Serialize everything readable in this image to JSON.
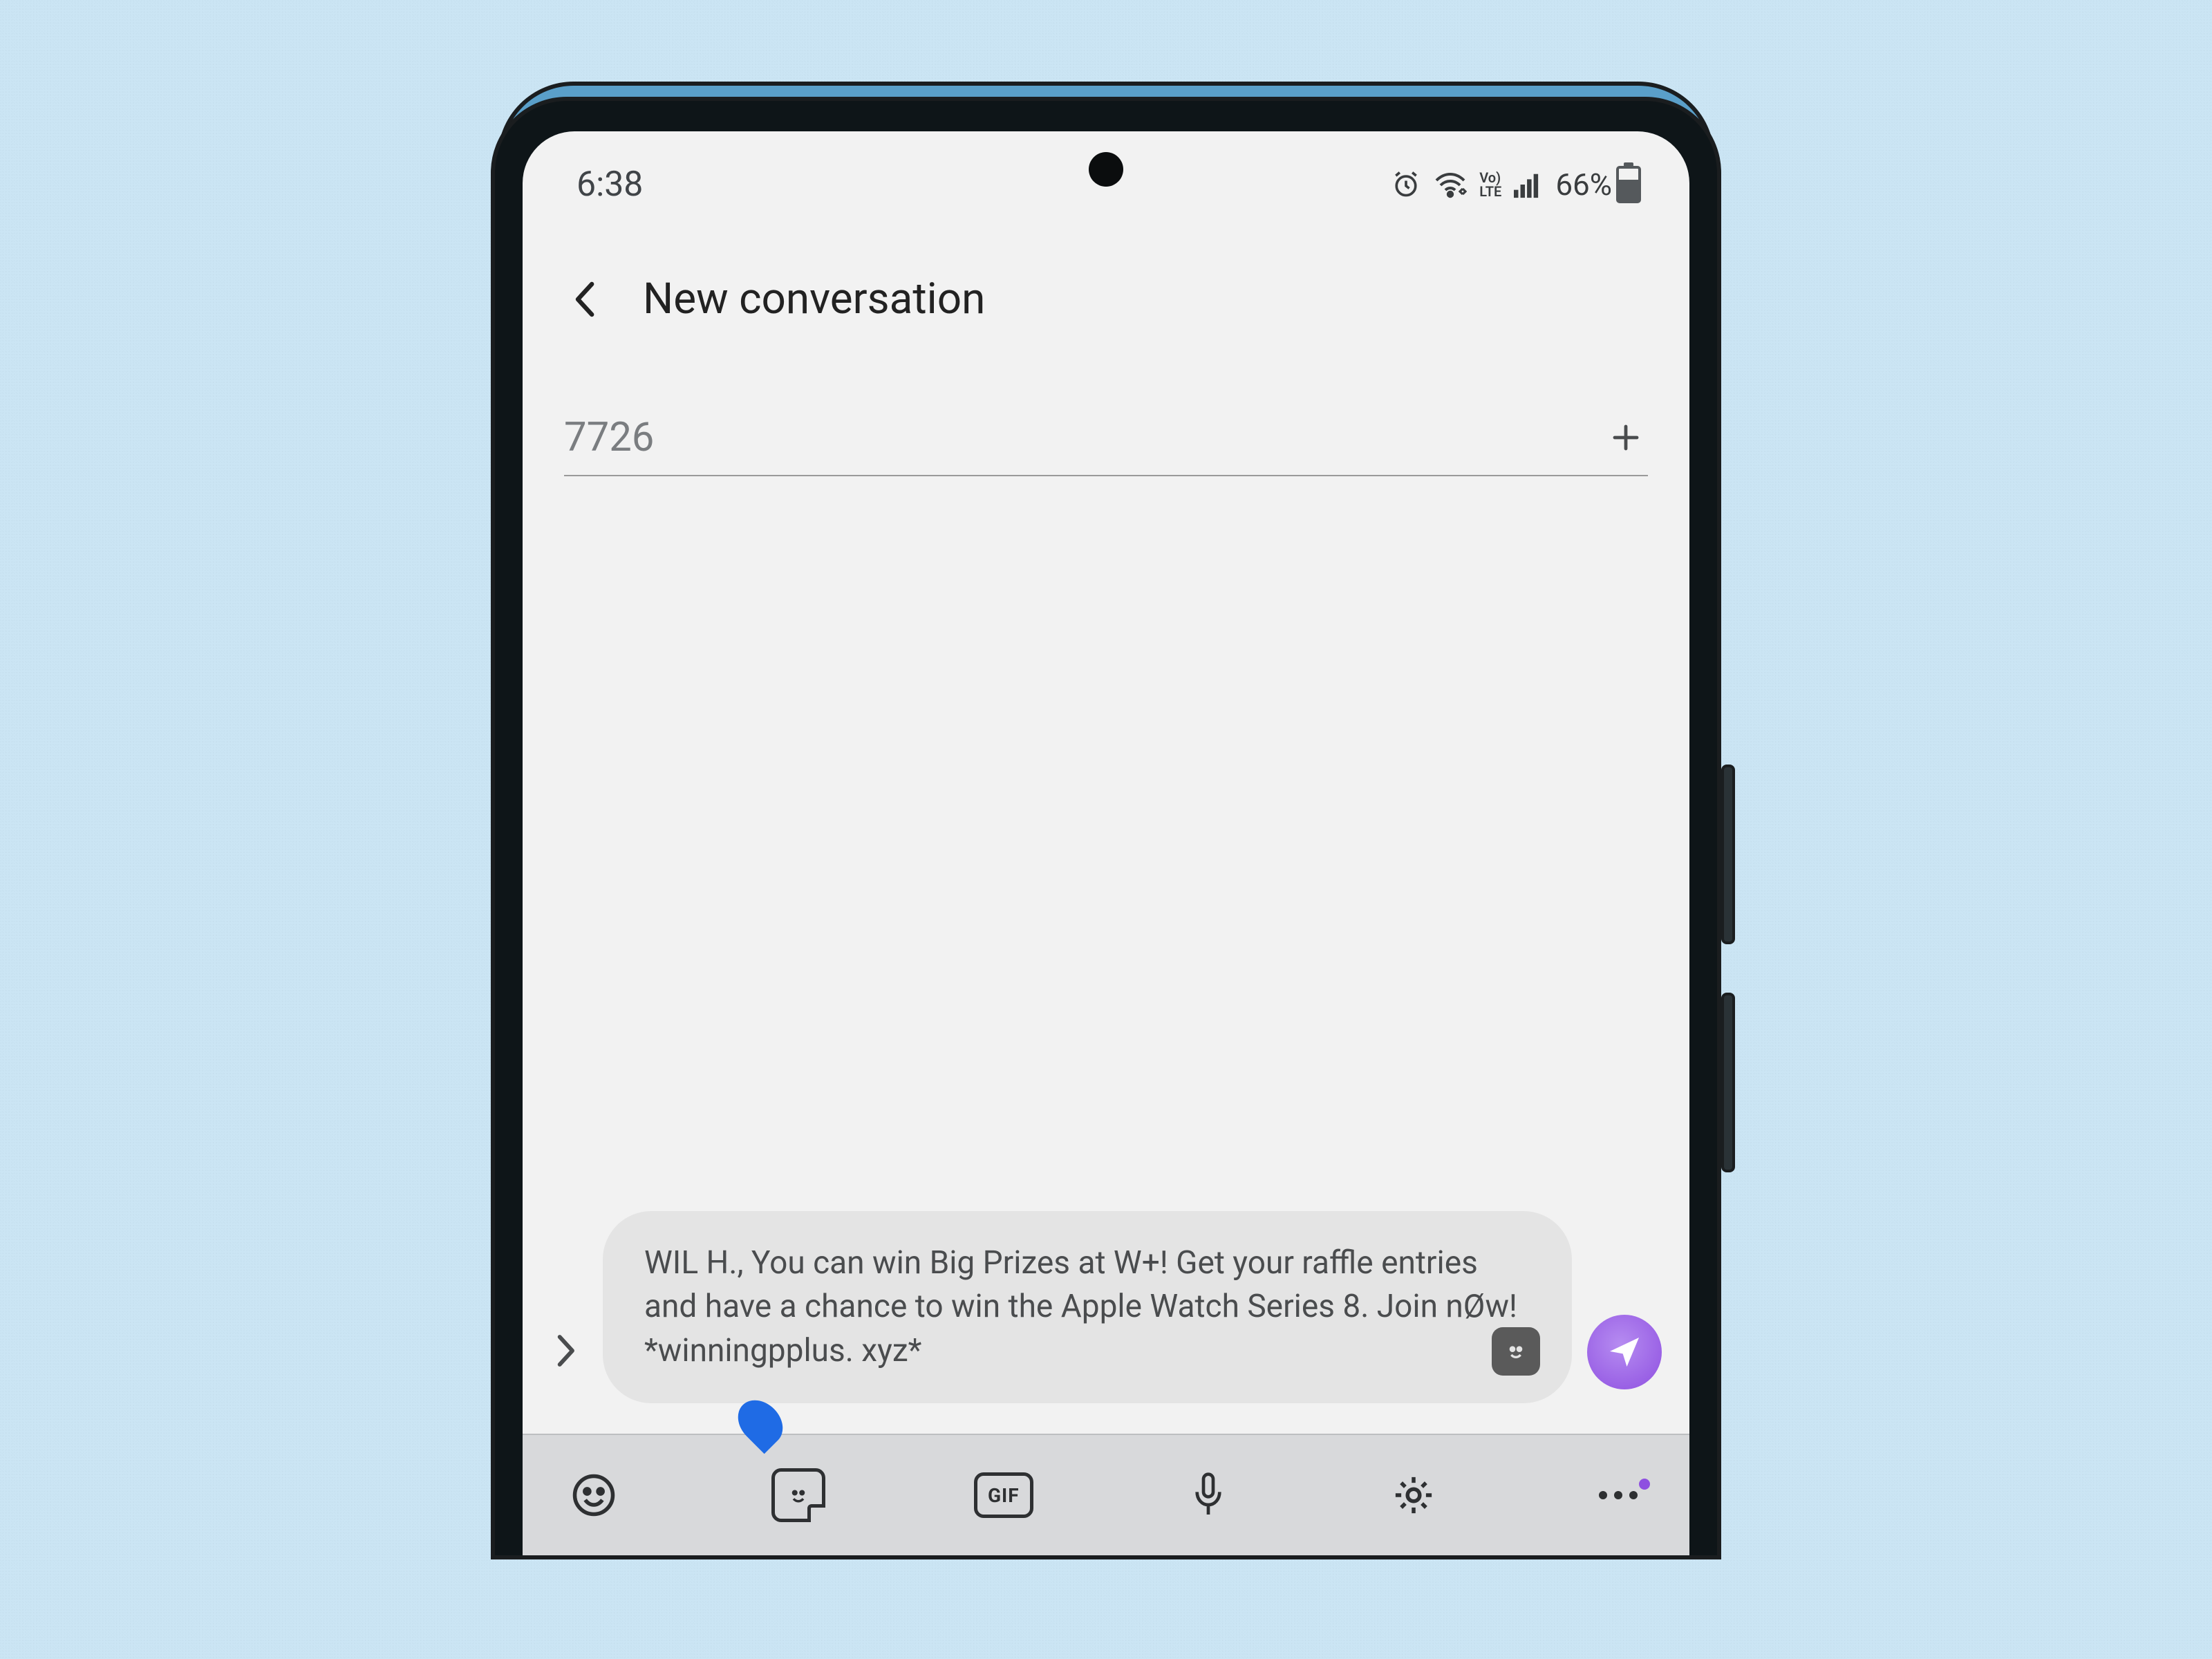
{
  "status": {
    "time": "6:38",
    "volte_top": "Vo)",
    "volte_bottom": "LTE",
    "battery_percent": "66%"
  },
  "header": {
    "title": "New conversation"
  },
  "recipient": {
    "value": "7726"
  },
  "compose": {
    "message": "WIL H., You can win Big Prizes at W+! Get your raffle entries and have a chance to win the Apple Watch Series 8. Join nØw! *winningpplus. xyz*"
  },
  "keyboard": {
    "gif_label": "GIF"
  }
}
